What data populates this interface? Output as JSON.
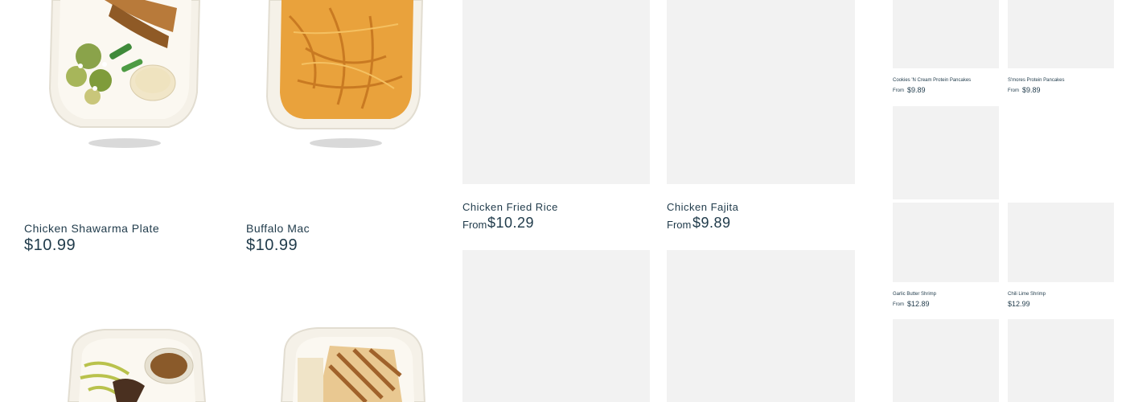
{
  "products": {
    "shawarma": {
      "name": "Chicken Shawarma Plate",
      "price": "$10.99"
    },
    "buffalo": {
      "name": "Buffalo Mac",
      "price": "$10.99"
    },
    "fried_rice": {
      "name": "Chicken Fried Rice",
      "from": "From",
      "price": "$10.29"
    },
    "fajita": {
      "name": "Chicken Fajita",
      "from": "From",
      "price": "$9.89"
    },
    "cookies_pancakes": {
      "name": "Cookies 'N Cream Protein Pancakes",
      "from": "From",
      "price": "$9.89"
    },
    "smores_pancakes": {
      "name": "S'mores Protein Pancakes",
      "from": "From",
      "price": "$9.89"
    },
    "garlic_shrimp": {
      "name": "Garlic Butter Shrimp",
      "from": "From",
      "price": "$12.89"
    },
    "chili_shrimp": {
      "name": "Chili Lime Shrimp",
      "price": "$12.99"
    }
  },
  "colors": {
    "text": "#1f3a4a",
    "placeholder": "#f2f2f2"
  }
}
